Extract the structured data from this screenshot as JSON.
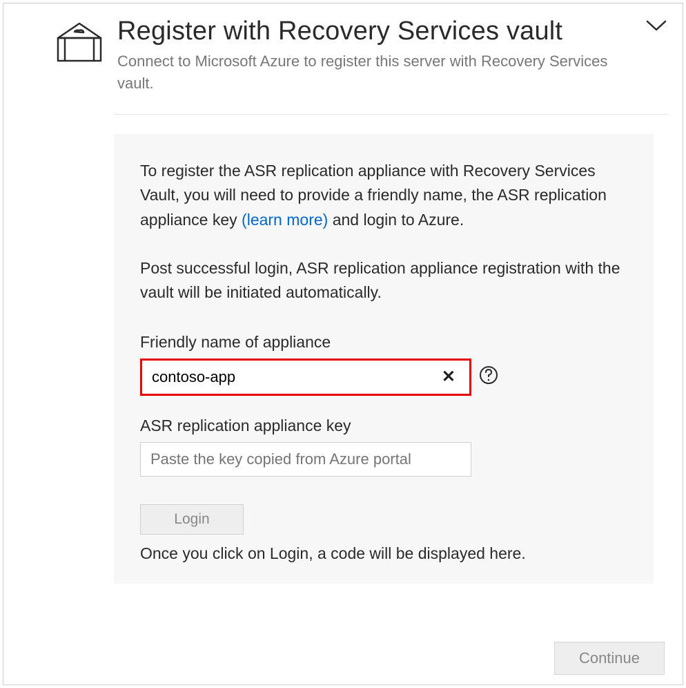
{
  "header": {
    "title": "Register with Recovery Services vault",
    "subtitle": "Connect to Microsoft Azure to register this server with Recovery Services vault."
  },
  "panel": {
    "info1_pre": "To register the ASR replication appliance with Recovery Services Vault, you will need to provide a friendly name, the ASR replication appliance key ",
    "info1_link": "(learn more)",
    "info1_post": " and login to Azure.",
    "info2": "Post successful login, ASR replication appliance registration with the vault will be initiated automatically.",
    "friendly_label": "Friendly name of appliance",
    "friendly_value": "contoso-app",
    "key_label": "ASR replication appliance key",
    "key_placeholder": "Paste the key copied from Azure portal",
    "login_label": "Login",
    "login_hint": "Once you click on Login, a code will be displayed here."
  },
  "footer": {
    "continue_label": "Continue"
  }
}
